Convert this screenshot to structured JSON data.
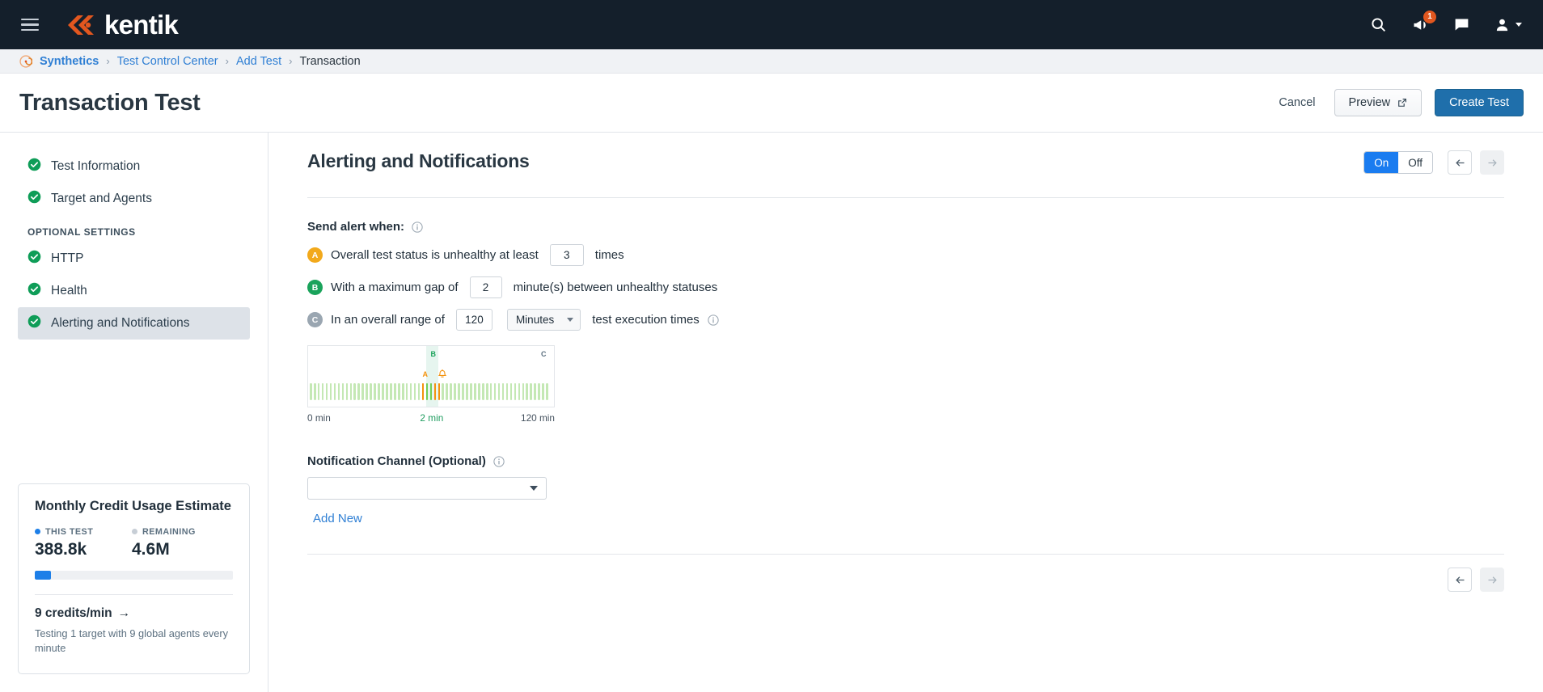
{
  "topnav": {
    "menu_icon": "hamburger-menu-icon",
    "brand": "kentik",
    "search_icon": "search-icon",
    "announcements_icon": "megaphone-icon",
    "announcements_badge": "1",
    "chat_icon": "chat-icon",
    "user_icon": "user-avatar-icon"
  },
  "breadcrumb": {
    "app_icon": "synthetics-icon",
    "items": [
      {
        "label": "Synthetics",
        "type": "link"
      },
      {
        "label": "Test Control Center",
        "type": "link"
      },
      {
        "label": "Add Test",
        "type": "link"
      },
      {
        "label": "Transaction",
        "type": "current"
      }
    ],
    "separator": "›"
  },
  "header": {
    "title": "Transaction Test",
    "cancel_label": "Cancel",
    "preview_label": "Preview",
    "preview_icon": "external-link-icon",
    "create_label": "Create Test"
  },
  "sidebar": {
    "items": [
      {
        "label": "Test Information",
        "status": "complete",
        "active": false
      },
      {
        "label": "Target and Agents",
        "status": "complete",
        "active": false
      }
    ],
    "section_label": "OPTIONAL SETTINGS",
    "optional_items": [
      {
        "label": "HTTP",
        "status": "complete",
        "active": false
      },
      {
        "label": "Health",
        "status": "complete",
        "active": false
      },
      {
        "label": "Alerting and Notifications",
        "status": "complete",
        "active": true
      }
    ],
    "credit_card": {
      "title": "Monthly Credit Usage Estimate",
      "this_test_label": "THIS TEST",
      "this_test_value": "388.8k",
      "remaining_label": "REMAINING",
      "remaining_value": "4.6M",
      "bar_percent": 8,
      "bar_color": "#1d7fe8",
      "rate": "9 credits/min",
      "rate_arrow": "→",
      "note": "Testing 1 target with 9 global agents every minute"
    }
  },
  "main": {
    "section_title": "Alerting and Notifications",
    "toggle": {
      "on_label": "On",
      "off_label": "Off",
      "selected": "On"
    },
    "nav_prev_icon": "arrow-left-icon",
    "nav_next_icon": "arrow-right-icon",
    "send_alert_label": "Send alert when:",
    "conditions": [
      {
        "badge": "A",
        "badge_color": "#f2a91b",
        "text_before": "Overall test status is unhealthy at least",
        "value": "3",
        "text_after": "times"
      },
      {
        "badge": "B",
        "badge_color": "#1aa35b",
        "text_before": "With a maximum gap of",
        "value": "2",
        "text_after": "minute(s) between unhealthy statuses"
      },
      {
        "badge": "C",
        "badge_color": "#9aa6b1",
        "text_before": "In an overall range of",
        "value": "120",
        "unit": "Minutes",
        "text_after": "test execution times"
      }
    ],
    "notification": {
      "label": "Notification Channel (Optional)",
      "value": "",
      "add_new_label": "Add New"
    }
  },
  "chart_data": {
    "type": "bar",
    "title": "Alert timeline preview",
    "xlabel": "",
    "ylabel": "",
    "x_ticks": [
      "0 min",
      "2 min",
      "120 min"
    ],
    "x_tick_colors": [
      "#44515e",
      "#1f9d5f",
      "#44515e"
    ],
    "xlim": [
      0,
      120
    ],
    "grid": false,
    "legend": "none",
    "bar_count": 60,
    "colors": {
      "healthy": "#c4e8b4",
      "unhealthy": "#f3930f",
      "gap": "#6fcf58",
      "highlight_band": "#e2f3ec"
    },
    "annotations": [
      {
        "label": "A",
        "color": "#f3930f",
        "bar_index": 28,
        "position": "above-bars"
      },
      {
        "label": "B",
        "color": "#1aa35b",
        "bar_index": 30,
        "position": "top"
      },
      {
        "label": "C",
        "color": "#5c7080",
        "bar_index": 59,
        "position": "top"
      },
      {
        "label": "bell-icon",
        "color": "#f3930f",
        "bar_index": 33,
        "position": "above-bars"
      }
    ],
    "bars": [
      {
        "i": 0,
        "state": "healthy"
      },
      {
        "i": 1,
        "state": "healthy"
      },
      {
        "i": 2,
        "state": "healthy"
      },
      {
        "i": 3,
        "state": "healthy"
      },
      {
        "i": 4,
        "state": "healthy"
      },
      {
        "i": 5,
        "state": "healthy"
      },
      {
        "i": 6,
        "state": "healthy"
      },
      {
        "i": 7,
        "state": "healthy"
      },
      {
        "i": 8,
        "state": "healthy"
      },
      {
        "i": 9,
        "state": "healthy"
      },
      {
        "i": 10,
        "state": "healthy"
      },
      {
        "i": 11,
        "state": "healthy"
      },
      {
        "i": 12,
        "state": "healthy"
      },
      {
        "i": 13,
        "state": "healthy"
      },
      {
        "i": 14,
        "state": "healthy"
      },
      {
        "i": 15,
        "state": "healthy"
      },
      {
        "i": 16,
        "state": "healthy"
      },
      {
        "i": 17,
        "state": "healthy"
      },
      {
        "i": 18,
        "state": "healthy"
      },
      {
        "i": 19,
        "state": "healthy"
      },
      {
        "i": 20,
        "state": "healthy"
      },
      {
        "i": 21,
        "state": "healthy"
      },
      {
        "i": 22,
        "state": "healthy"
      },
      {
        "i": 23,
        "state": "healthy"
      },
      {
        "i": 24,
        "state": "healthy"
      },
      {
        "i": 25,
        "state": "healthy"
      },
      {
        "i": 26,
        "state": "healthy"
      },
      {
        "i": 27,
        "state": "healthy"
      },
      {
        "i": 28,
        "state": "unhealthy"
      },
      {
        "i": 29,
        "state": "gap"
      },
      {
        "i": 30,
        "state": "gap"
      },
      {
        "i": 31,
        "state": "unhealthy"
      },
      {
        "i": 32,
        "state": "unhealthy"
      },
      {
        "i": 33,
        "state": "healthy"
      },
      {
        "i": 34,
        "state": "healthy"
      },
      {
        "i": 35,
        "state": "healthy"
      },
      {
        "i": 36,
        "state": "healthy"
      },
      {
        "i": 37,
        "state": "healthy"
      },
      {
        "i": 38,
        "state": "healthy"
      },
      {
        "i": 39,
        "state": "healthy"
      },
      {
        "i": 40,
        "state": "healthy"
      },
      {
        "i": 41,
        "state": "healthy"
      },
      {
        "i": 42,
        "state": "healthy"
      },
      {
        "i": 43,
        "state": "healthy"
      },
      {
        "i": 44,
        "state": "healthy"
      },
      {
        "i": 45,
        "state": "healthy"
      },
      {
        "i": 46,
        "state": "healthy"
      },
      {
        "i": 47,
        "state": "healthy"
      },
      {
        "i": 48,
        "state": "healthy"
      },
      {
        "i": 49,
        "state": "healthy"
      },
      {
        "i": 50,
        "state": "healthy"
      },
      {
        "i": 51,
        "state": "healthy"
      },
      {
        "i": 52,
        "state": "healthy"
      },
      {
        "i": 53,
        "state": "healthy"
      },
      {
        "i": 54,
        "state": "healthy"
      },
      {
        "i": 55,
        "state": "healthy"
      },
      {
        "i": 56,
        "state": "healthy"
      },
      {
        "i": 57,
        "state": "healthy"
      },
      {
        "i": 58,
        "state": "healthy"
      },
      {
        "i": 59,
        "state": "healthy"
      }
    ]
  }
}
